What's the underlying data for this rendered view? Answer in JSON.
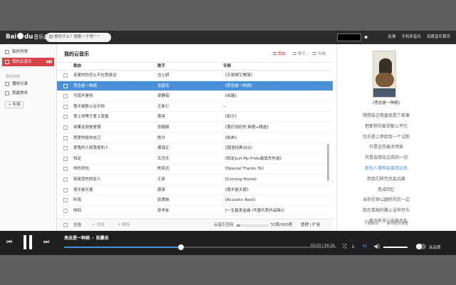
{
  "header": {
    "logo_text": "Bai",
    "logo_suffix": "du",
    "app_name": "音乐盒",
    "search_placeholder": "想听什么？搜索一下吧^^",
    "links": [
      "反馈",
      "手机听音乐",
      "百度音乐首页"
    ]
  },
  "sidebar": {
    "items": [
      {
        "label": "临时列表",
        "icon": "list-icon"
      },
      {
        "label": "我的云音乐",
        "icon": "cloud-icon",
        "active": true
      }
    ],
    "section_title": "我的列表",
    "list_items": [
      {
        "label": "播放记录",
        "icon": "history-icon"
      },
      {
        "label": "我最常听",
        "icon": "star-icon"
      }
    ],
    "new_button": "+ 新建"
  },
  "content": {
    "title": "我的云音乐",
    "view_tabs": [
      "歌曲",
      "歌手",
      "专辑"
    ],
    "columns": {
      "song": "歌曲",
      "artist": "歌手",
      "album": "专辑"
    },
    "rows": [
      {
        "song": "亲爱的你怎么不在我身边",
        "artist": "庄心妍",
        "album": "《又欲嫁又美丽》"
      },
      {
        "song": "思念是一种病",
        "artist": "张震岳",
        "album": "《思念是一种病》",
        "selected": true
      },
      {
        "song": "可惜不是你",
        "artist": "梁静茹",
        "album": "《丝路》"
      },
      {
        "song": "我不是那么在乎你",
        "artist": "王新仁",
        "album": "--"
      },
      {
        "song": "爱上你等于爱上寂寞",
        "artist": "那英",
        "album": "《如今》"
      },
      {
        "song": "如果这就是爱情",
        "artist": "张靓颖",
        "album": "《我们说好的 新歌+精选》"
      },
      {
        "song": "把爱你给你自己",
        "artist": "陈升",
        "album": "《私奔》"
      },
      {
        "song": "爱我的人和我爱的人",
        "artist": "裘海正",
        "album": "《国语经典101》"
      },
      {
        "song": "知足",
        "artist": "五月天",
        "album": "《知足Just My Pride最真杰作选》"
      },
      {
        "song": "你的背包",
        "artist": "陈奕迅",
        "album": "《Special Thanks To》"
      },
      {
        "song": "容易受伤的女人",
        "artist": "王菲",
        "album": "《Coming Home》"
      },
      {
        "song": "我不是天使",
        "artist": "那英",
        "album": "《我不是天使》"
      },
      {
        "song": "听海",
        "artist": "张惠妹",
        "album": "《Acoustic Best》"
      },
      {
        "song": "吻别",
        "artist": "张学友",
        "album": "《一生最爱金曲 (华夏代表作品辑)》"
      }
    ],
    "footer": {
      "select_all": "全选",
      "add": "+ 添加",
      "delete": "✕ 删除",
      "space_label": "云音乐空间",
      "space_used_fraction": 0.1,
      "space_text": "50首/500首",
      "manage": "管理 | 扩容"
    }
  },
  "right": {
    "album_title": "《思念是一种病》",
    "lyrics": [
      "想想自己简直就是个笨蛋",
      "把那样的爱却那么平凡",
      "也许是上帝给我一个试炼",
      "只是这伤痕太明显",
      "只是会想念过去的一切",
      "那些人事物会离我远去",
      "而我们终究也会远离",
      "变成回忆",
      "当你在穿山越岭的另一边",
      "我在孤独的路上没有尽头",
      "一辈子有多少的来不及"
    ],
    "current_lyric_index": 5,
    "footer": [
      "下载歌词",
      "歌词信息报错"
    ]
  },
  "player": {
    "title": "思念是一种病",
    "artist": "张震岳",
    "separator": "-",
    "elapsed": "02:03",
    "duration": "04:16",
    "progress_fraction": 0.43,
    "hq_label": "高品质"
  }
}
